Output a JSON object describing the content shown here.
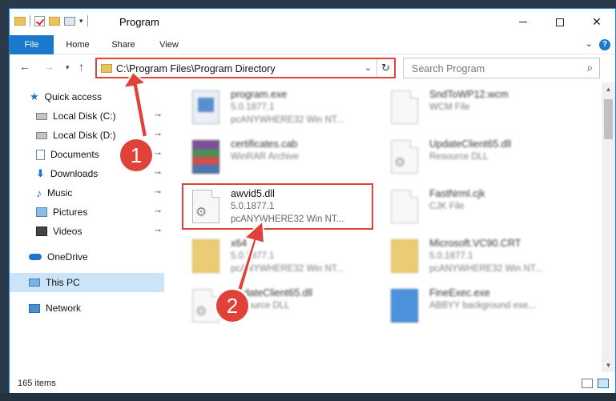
{
  "window": {
    "title": "Program",
    "minimize": "—",
    "maximize": "☐",
    "close": "✕"
  },
  "ribbon": {
    "tabs": [
      "File",
      "Home",
      "Share",
      "View"
    ],
    "expand_icon": "chevron-down-icon",
    "help": "?"
  },
  "nav": {
    "back": "←",
    "forward": "→",
    "recent": "▾",
    "up": "↑",
    "address_path": "C:\\Program Files\\Program Directory",
    "address_chevron": "⌄",
    "refresh": "↻",
    "search_placeholder": "Search Program",
    "search_icon": "⌕"
  },
  "sidebar": {
    "items": [
      {
        "label": "Quick access",
        "icon": "star-icon"
      },
      {
        "label": "Local Disk (C:)",
        "icon": "disk-icon",
        "pinned": true
      },
      {
        "label": "Local Disk (D:)",
        "icon": "disk-icon",
        "pinned": true
      },
      {
        "label": "Documents",
        "icon": "documents-icon",
        "pinned": true
      },
      {
        "label": "Downloads",
        "icon": "downloads-icon",
        "pinned": true
      },
      {
        "label": "Music",
        "icon": "music-icon",
        "pinned": true
      },
      {
        "label": "Pictures",
        "icon": "pictures-icon",
        "pinned": true
      },
      {
        "label": "Videos",
        "icon": "videos-icon",
        "pinned": true
      },
      {
        "label": "OneDrive",
        "icon": "onedrive-icon"
      },
      {
        "label": "This PC",
        "icon": "this-pc-icon",
        "selected": true
      },
      {
        "label": "Network",
        "icon": "network-icon"
      }
    ],
    "pin_glyph": "📌"
  },
  "files": [
    {
      "name": "program.exe",
      "line2": "5.0.1877.1",
      "line3": "pcANYWHERE32 Win NT...",
      "icon": "exe-icon"
    },
    {
      "name": "SndToWP12.wcm",
      "line2": "WCM File",
      "line3": "",
      "icon": "file-icon"
    },
    {
      "name": "certificates.cab",
      "line2": "WinRAR Archive",
      "line3": "",
      "icon": "winrar-icon"
    },
    {
      "name": "UpdateClient65.dll",
      "line2": "Resource DLL",
      "line3": "",
      "icon": "dll-icon"
    },
    {
      "name": "awvid5.dll",
      "line2": "5.0.1877.1",
      "line3": "pcANYWHERE32 Win NT...",
      "icon": "dll-icon"
    },
    {
      "name": "FastNrml.cjk",
      "line2": "CJK File",
      "line3": "",
      "icon": "file-icon"
    },
    {
      "name": "x64",
      "line2": "5.0.1877.1",
      "line3": "pcANYWHERE32 Win NT...",
      "icon": "folder-icon"
    },
    {
      "name": "Microsoft.VC90.CRT",
      "line2": "5.0.1877.1",
      "line3": "pcANYWHERE32 Win NT...",
      "icon": "folder-icon"
    },
    {
      "name": "UpdateClient65.dll",
      "line2": "Resource DLL",
      "line3": "",
      "icon": "dll-icon"
    },
    {
      "name": "FineExec.exe",
      "line2": "ABBYY background exe...",
      "line3": "",
      "icon": "fineexec-icon"
    }
  ],
  "status": {
    "item_count": "165 items"
  },
  "annotations": {
    "marker1": "1",
    "marker2": "2",
    "color": "#e0423a"
  },
  "colors": {
    "accent": "#1979ca",
    "highlight_box": "#e0423a",
    "selection": "#cce4f7"
  }
}
